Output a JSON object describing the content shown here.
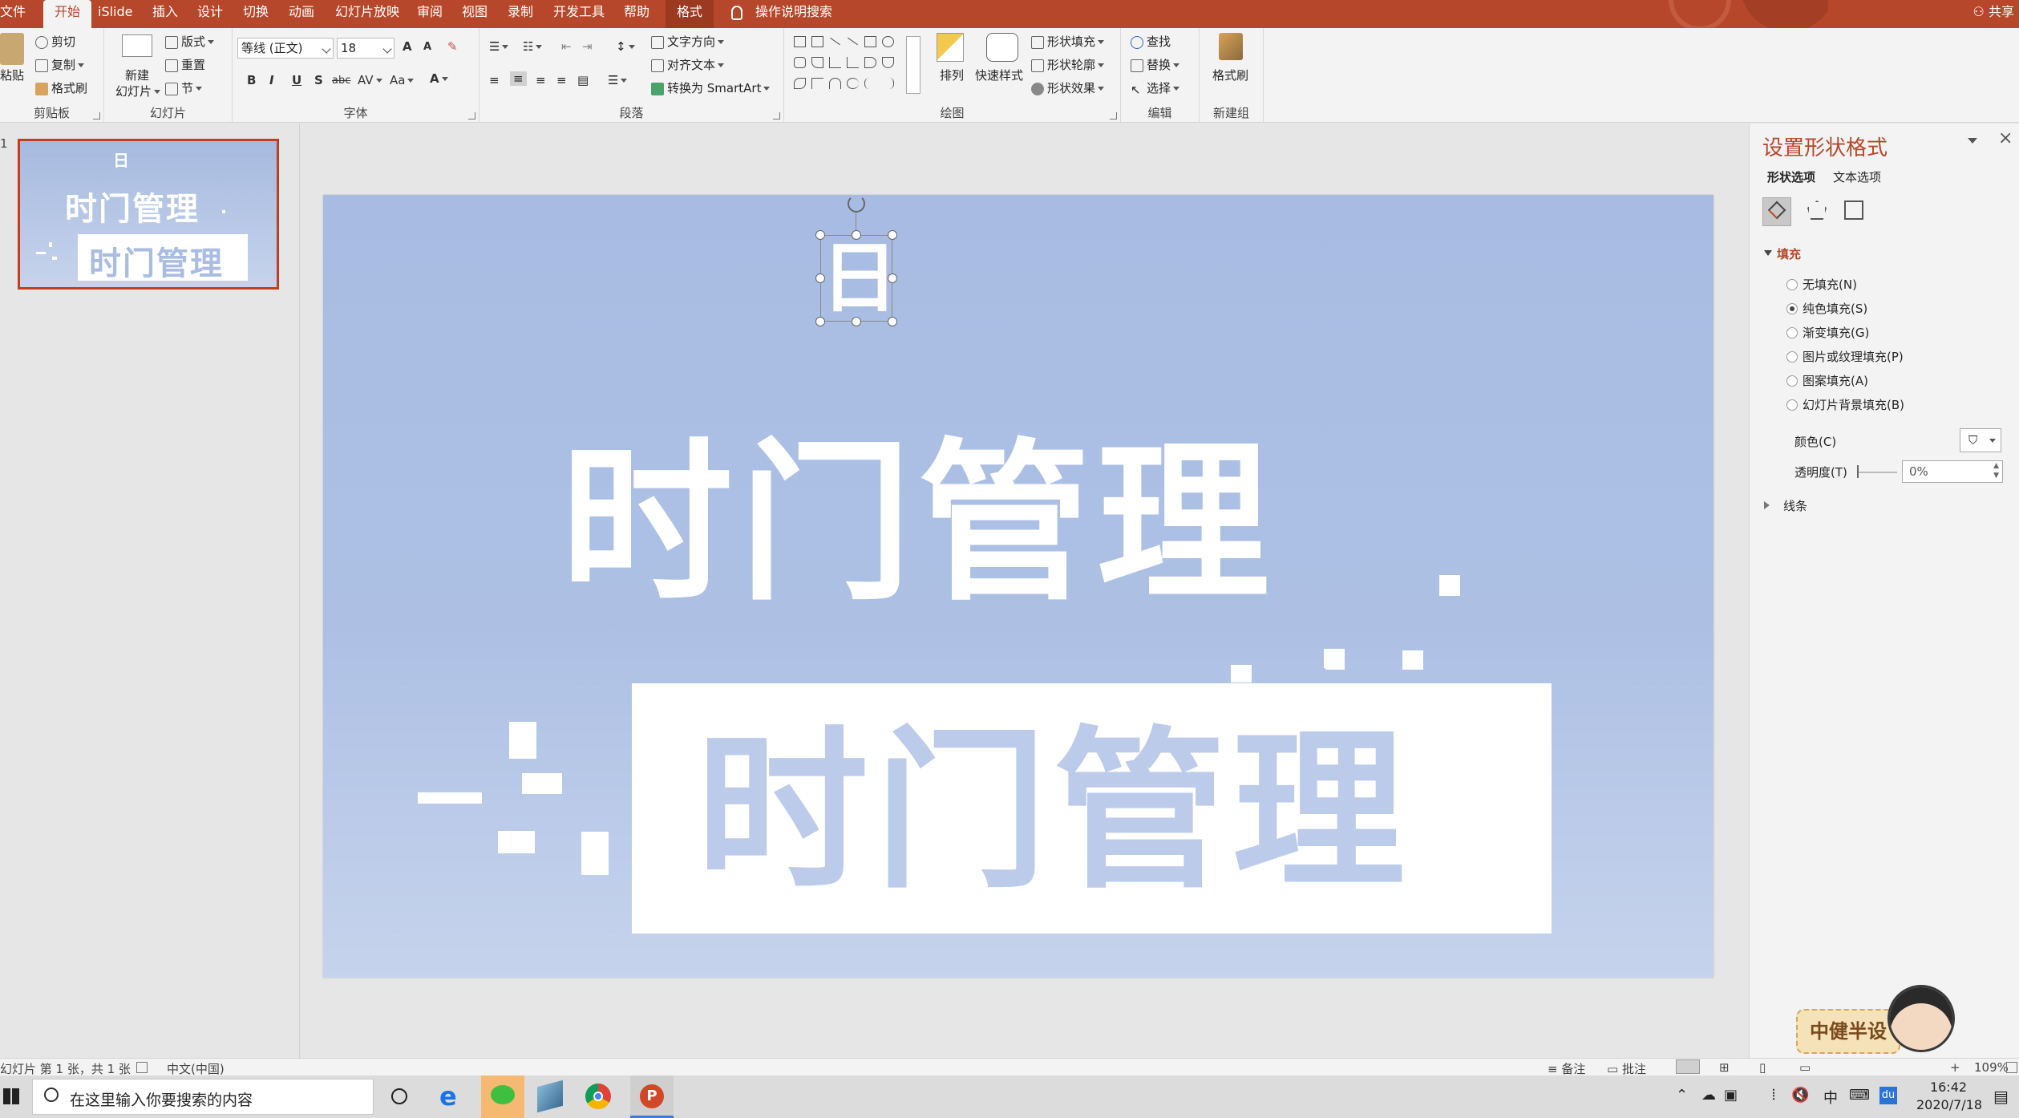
{
  "menu": {
    "tabs": [
      "文件",
      "开始",
      "iSlide",
      "插入",
      "设计",
      "切换",
      "动画",
      "幻灯片放映",
      "审阅",
      "视图",
      "录制",
      "开发工具",
      "帮助",
      "格式"
    ],
    "active": "开始",
    "tell_me": "操作说明搜索",
    "share": "共享"
  },
  "ribbon": {
    "clipboard": {
      "label": "剪贴板",
      "paste": "粘贴",
      "cut": "剪切",
      "copy": "复制",
      "format_painter": "格式刷"
    },
    "slides": {
      "label": "幻灯片",
      "new_slide": "新建",
      "new_slide2": "幻灯片",
      "layout": "版式",
      "reset": "重置",
      "section": "节"
    },
    "font": {
      "label": "字体",
      "font_name": "等线 (正文)",
      "font_size": "18",
      "bold": "B",
      "italic": "I",
      "underline": "U",
      "shadow": "S",
      "strike": "abc",
      "spacing": "AV",
      "case": "Aa",
      "color": "A",
      "grow": "A",
      "shrink": "A"
    },
    "paragraph": {
      "label": "段落",
      "text_direction": "文字方向",
      "align_text": "对齐文本",
      "smartart": "转换为 SmartArt"
    },
    "drawing": {
      "label": "绘图",
      "arrange": "排列",
      "quick_styles": "快速样式",
      "shape_fill": "形状填充",
      "shape_outline": "形状轮廓",
      "shape_effects": "形状效果"
    },
    "editing": {
      "label": "编辑",
      "find": "查找",
      "replace": "替换",
      "select": "选择"
    },
    "newgroup": {
      "label": "新建组",
      "format_painter": "格式刷"
    }
  },
  "thumbnail": {
    "number": "1",
    "title": "时门管理",
    "subtitle": "时门管理",
    "tiny": "日"
  },
  "slide": {
    "icon_char": "日",
    "title": "时门管理",
    "subtitle": "时门管理"
  },
  "format_pane": {
    "title": "设置形状格式",
    "tabs": [
      "形状选项",
      "文本选项"
    ],
    "fill_section": "填充",
    "options": [
      "无填充(N)",
      "纯色填充(S)",
      "渐变填充(G)",
      "图片或纹理填充(P)",
      "图案填充(A)",
      "幻灯片背景填充(B)"
    ],
    "selected_index": 1,
    "color_label": "颜色(C)",
    "transparency_label": "透明度(T)",
    "transparency_value": "0%",
    "line_section": "线条"
  },
  "watermark": {
    "text": "中健半设"
  },
  "status": {
    "slide_info": "幻灯片 第 1 张，共 1 张",
    "language": "中文(中国)",
    "notes": "备注",
    "comments": "批注",
    "zoom": "109%"
  },
  "taskbar": {
    "search_placeholder": "在这里输入你要搜索的内容",
    "time": "16:42",
    "date": "2020/7/18"
  },
  "colors": {
    "accent": "#b7472a",
    "slide_bg": "#a8bce3",
    "text_white": "#ffffff"
  }
}
